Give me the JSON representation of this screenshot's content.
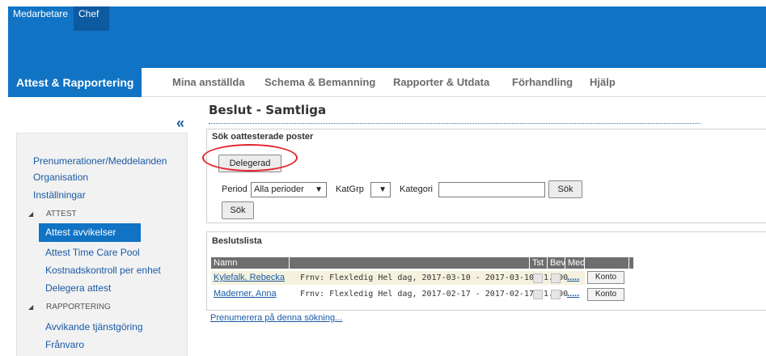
{
  "topbar": {
    "roles": [
      "Medarbetare",
      "Chef"
    ],
    "active_role": "Chef",
    "color": "#1173c4"
  },
  "nav": {
    "items": [
      "Attest & Rapportering",
      "Mina anställda",
      "Schema & Bemanning",
      "Rapporter & Utdata",
      "Förhandling",
      "Hjälp"
    ],
    "active": "Attest & Rapportering"
  },
  "sidebar": {
    "collapse_icon": "«",
    "links": [
      "Prenumerationer/Meddelanden",
      "Organisation",
      "Inställningar"
    ],
    "sections": [
      {
        "title": "ATTEST",
        "items": [
          "Attest avvikelser",
          "Attest Time Care Pool",
          "Kostnadskontroll per enhet",
          "Delegera attest"
        ]
      },
      {
        "title": "RAPPORTERING",
        "items": [
          "Avvikande tjänstgöring",
          "Frånvaro"
        ]
      }
    ],
    "active_item": "Attest avvikelser"
  },
  "page": {
    "title": "Beslut - Samtliga"
  },
  "search": {
    "heading": "Sök oattesterade poster",
    "delegerad_label": "Delegerad",
    "period_label": "Period",
    "period_value": "Alla perioder",
    "katgrp_label": "KatGrp",
    "katgrp_value": "",
    "kategori_label": "Kategori",
    "kategori_value": "",
    "sok_label": "Sök",
    "sok2_label": "Sök"
  },
  "beslutslista": {
    "heading": "Beslutslista",
    "columns": [
      "Namn",
      "",
      "Tst",
      "Bev",
      "Med",
      ""
    ],
    "rows": [
      {
        "name": "Kylefalk, Rebecka",
        "desc": "Frnv: Flexledig Hel dag, 2017-03-10 - 2017-03-10, 1.000",
        "med": ".....",
        "konto": "Konto"
      },
      {
        "name": "Maderner, Anna",
        "desc": "Frnv: Flexledig Hel dag, 2017-02-17 - 2017-02-17, 1.000",
        "med": ".....",
        "konto": "Konto"
      }
    ],
    "subscribe_link": "Prenumerera på denna sökning..."
  },
  "annotation_color": "#e5232b"
}
